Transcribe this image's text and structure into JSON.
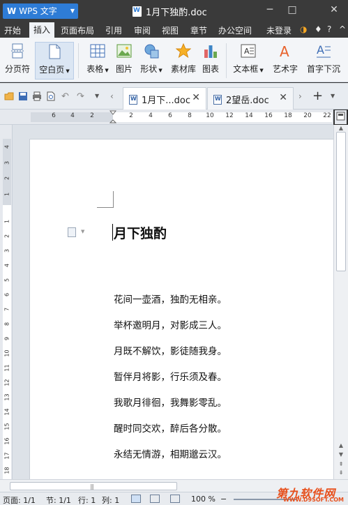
{
  "app": {
    "menu_button": "WPS 文字",
    "document_title": "1月下独酌.doc"
  },
  "menu": {
    "items": [
      "开始",
      "插入",
      "页面布局",
      "引用",
      "审阅",
      "视图",
      "章节",
      "办公空间"
    ],
    "active": "插入",
    "login": "未登录"
  },
  "ribbon": {
    "page_break": "分页符",
    "blank_page": "空白页",
    "table": "表格",
    "picture": "图片",
    "shape": "形状",
    "material_lib": "素材库",
    "chart": "图表",
    "textbox": "文本框",
    "wordart": "艺术字",
    "dropcap": "首字下沉"
  },
  "tabs": [
    {
      "label": "1月下...doc",
      "active": true
    },
    {
      "label": "2望岳.doc",
      "active": false
    }
  ],
  "rulers": {
    "h_ticks": [
      "6",
      "4",
      "2",
      "2",
      "4",
      "6",
      "8",
      "10",
      "12",
      "14",
      "16",
      "18",
      "20",
      "22"
    ],
    "v_ticks": [
      "4",
      "3",
      "2",
      "1",
      "1",
      "2",
      "3",
      "4",
      "5",
      "6",
      "7",
      "8",
      "9",
      "10",
      "11",
      "12",
      "13",
      "14",
      "15",
      "16",
      "17",
      "18"
    ]
  },
  "document": {
    "title": "月下独酌",
    "lines": [
      "花间一壶酒，独酌无相亲。",
      "举杯邀明月，对影成三人。",
      "月既不解饮，影徒随我身。",
      "暂伴月将影，行乐须及春。",
      "我歌月徘徊，我舞影零乱。",
      "醒时同交欢，醉后各分散。",
      "永结无情游，相期邈云汉。"
    ]
  },
  "status": {
    "page": "页面: 1/1",
    "section": "节: 1/1",
    "row": "行: 1",
    "col": "列: 1",
    "zoom": "100 %"
  },
  "watermark": {
    "main": "第九软件网",
    "sub": "WWW.D9SOFT.COM"
  },
  "colors": {
    "accent": "#2e7cd6",
    "titlebar": "#3a3a3a",
    "watermark": "#e8501c"
  }
}
